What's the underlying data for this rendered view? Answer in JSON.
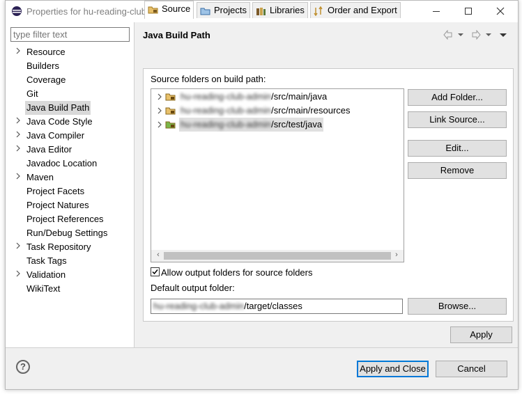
{
  "window": {
    "title": "Properties for hu-reading-club-admin",
    "controls": {
      "minimize": "—",
      "maximize": "☐",
      "close": "✕"
    }
  },
  "filter": {
    "placeholder": "type filter text"
  },
  "tree": {
    "items": [
      {
        "label": "Resource",
        "expandable": true,
        "selected": false
      },
      {
        "label": "Builders",
        "expandable": false,
        "selected": false
      },
      {
        "label": "Coverage",
        "expandable": false,
        "selected": false
      },
      {
        "label": "Git",
        "expandable": false,
        "selected": false
      },
      {
        "label": "Java Build Path",
        "expandable": false,
        "selected": true
      },
      {
        "label": "Java Code Style",
        "expandable": true,
        "selected": false
      },
      {
        "label": "Java Compiler",
        "expandable": true,
        "selected": false
      },
      {
        "label": "Java Editor",
        "expandable": true,
        "selected": false
      },
      {
        "label": "Javadoc Location",
        "expandable": false,
        "selected": false
      },
      {
        "label": "Maven",
        "expandable": true,
        "selected": false
      },
      {
        "label": "Project Facets",
        "expandable": false,
        "selected": false
      },
      {
        "label": "Project Natures",
        "expandable": false,
        "selected": false
      },
      {
        "label": "Project References",
        "expandable": false,
        "selected": false
      },
      {
        "label": "Run/Debug Settings",
        "expandable": false,
        "selected": false
      },
      {
        "label": "Task Repository",
        "expandable": true,
        "selected": false
      },
      {
        "label": "Task Tags",
        "expandable": false,
        "selected": false
      },
      {
        "label": "Validation",
        "expandable": true,
        "selected": false
      },
      {
        "label": "WikiText",
        "expandable": false,
        "selected": false
      }
    ]
  },
  "page": {
    "title": "Java Build Path"
  },
  "tabs": [
    {
      "label": "Source",
      "icon": "source-folder-icon",
      "active": true
    },
    {
      "label": "Projects",
      "icon": "projects-icon",
      "active": false
    },
    {
      "label": "Libraries",
      "icon": "libraries-icon",
      "active": false
    },
    {
      "label": "Order and Export",
      "icon": "order-export-icon",
      "active": false
    }
  ],
  "source": {
    "label": "Source folders on build path:",
    "folders": [
      {
        "blurred": "hu-reading-club-admin",
        "suffix": "/src/main/java",
        "selected": false
      },
      {
        "blurred": "hu-reading-club-admin",
        "suffix": "/src/main/resources",
        "selected": false
      },
      {
        "blurred": "hu-reading-club-admin",
        "suffix": "/src/test/java",
        "selected": true
      }
    ],
    "buttons": {
      "add_folder": "Add Folder...",
      "link_source": "Link Source...",
      "edit": "Edit...",
      "remove": "Remove"
    },
    "allow_output_label": "Allow output folders for source folders",
    "allow_output_checked": true,
    "default_output_label": "Default output folder:",
    "default_output_blurred": "hu-reading-club-admin",
    "default_output_suffix": "/target/classes",
    "browse": "Browse..."
  },
  "footer": {
    "apply": "Apply",
    "apply_and_close": "Apply and Close",
    "cancel": "Cancel",
    "help": "?"
  }
}
